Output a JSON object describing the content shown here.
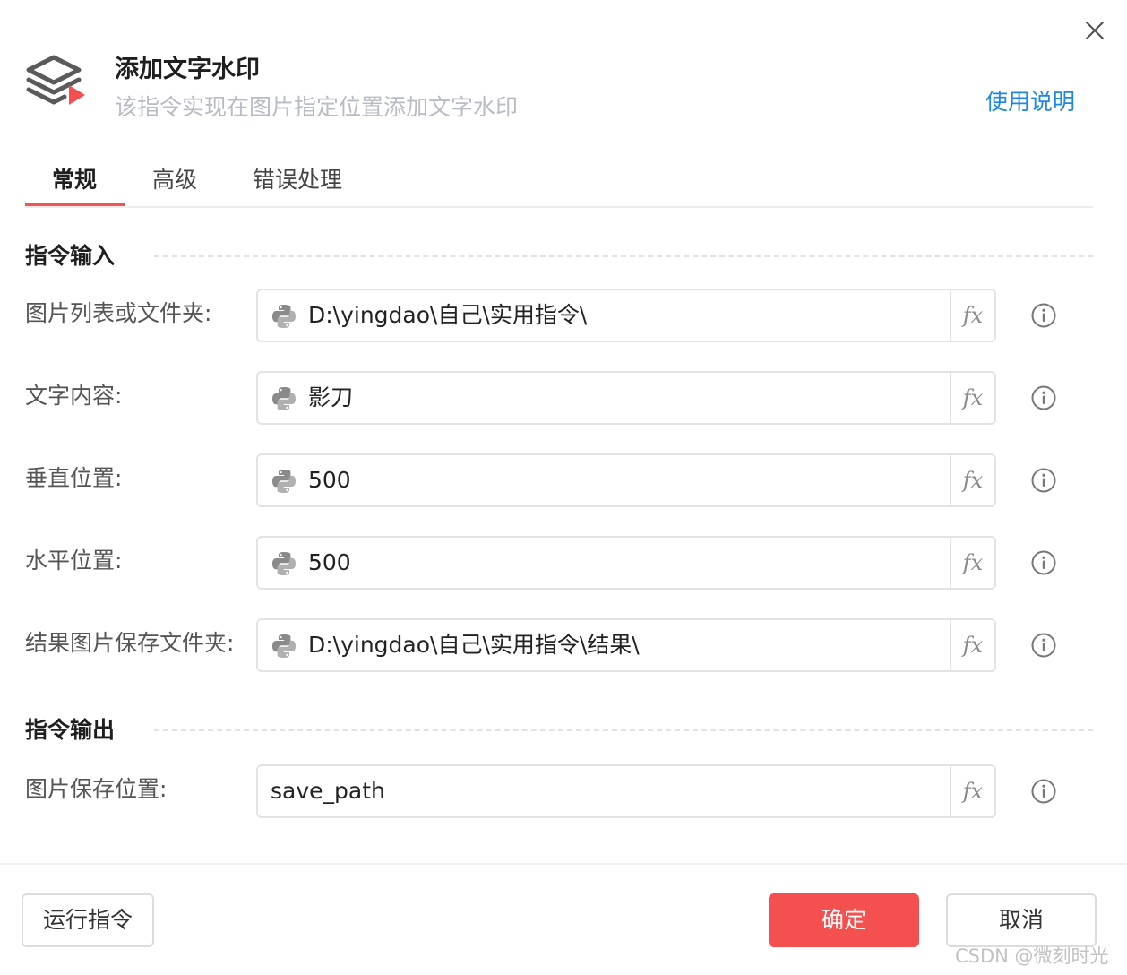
{
  "dialog": {
    "title": "添加文字水印",
    "subtitle": "该指令实现在图片指定位置添加文字水印",
    "help_link": "使用说明"
  },
  "tabs": [
    {
      "label": "常规",
      "active": true
    },
    {
      "label": "高级",
      "active": false
    },
    {
      "label": "错误处理",
      "active": false
    }
  ],
  "input_section": {
    "title": "指令输入",
    "fields": [
      {
        "label": "图片列表或文件夹:",
        "value": "D:\\yingdao\\自己\\实用指令\\",
        "python_icon": true
      },
      {
        "label": "文字内容:",
        "value": "影刀",
        "python_icon": true
      },
      {
        "label": "垂直位置:",
        "value": "500",
        "python_icon": true
      },
      {
        "label": "水平位置:",
        "value": "500",
        "python_icon": true
      },
      {
        "label": "结果图片保存文件夹:",
        "value": "D:\\yingdao\\自己\\实用指令\\结果\\",
        "python_icon": true
      }
    ]
  },
  "output_section": {
    "title": "指令输出",
    "fields": [
      {
        "label": "图片保存位置:",
        "value": "save_path",
        "python_icon": false
      }
    ]
  },
  "fx_label": "fx",
  "footer": {
    "run_label": "运行指令",
    "ok_label": "确定",
    "cancel_label": "取消"
  },
  "watermark": "CSDN @微刻时光",
  "icons": {
    "close": "close-icon",
    "header": "layers-play-icon",
    "python": "python-icon",
    "fx": "function-icon",
    "info": "info-icon"
  },
  "colors": {
    "accent": "#f55050",
    "link": "#1e88e5",
    "subtitle": "#b8bcc4"
  }
}
